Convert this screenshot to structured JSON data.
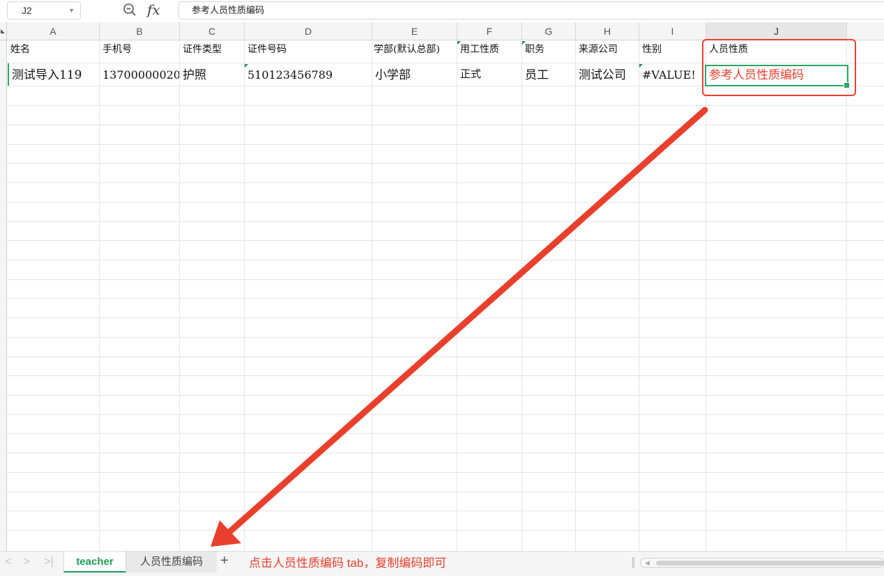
{
  "formula_bar": {
    "cell_ref": "J2",
    "fx_label": "fx",
    "formula_value": "参考人员性质编码"
  },
  "columns": [
    "A",
    "B",
    "C",
    "D",
    "E",
    "F",
    "G",
    "H",
    "I",
    "J"
  ],
  "active_column": "J",
  "rows": [
    [
      "姓名",
      "手机号",
      "证件类型",
      "证件号码",
      "学部(默认总部)",
      "用工性质",
      "职务",
      "来源公司",
      "性别",
      "人员性质"
    ],
    [
      "测试导入119",
      "13700000020",
      "护照",
      "510123456789",
      "小学部",
      "正式",
      "员工",
      "测试公司",
      "#VALUE!",
      "参考人员性质编码"
    ]
  ],
  "highlight_text_color": "#e8402d",
  "accent_color": "#2aa566",
  "sheet_tabs": {
    "active": "teacher",
    "other": "人员性质编码",
    "add_label": "+",
    "note": "点击人员性质编码 tab，复制编码即可"
  },
  "icons": [
    "zoom-icon",
    "fx-icon",
    "chevron-left-icon",
    "chevron-right-icon",
    "last-sheet-icon",
    "plus-icon"
  ]
}
